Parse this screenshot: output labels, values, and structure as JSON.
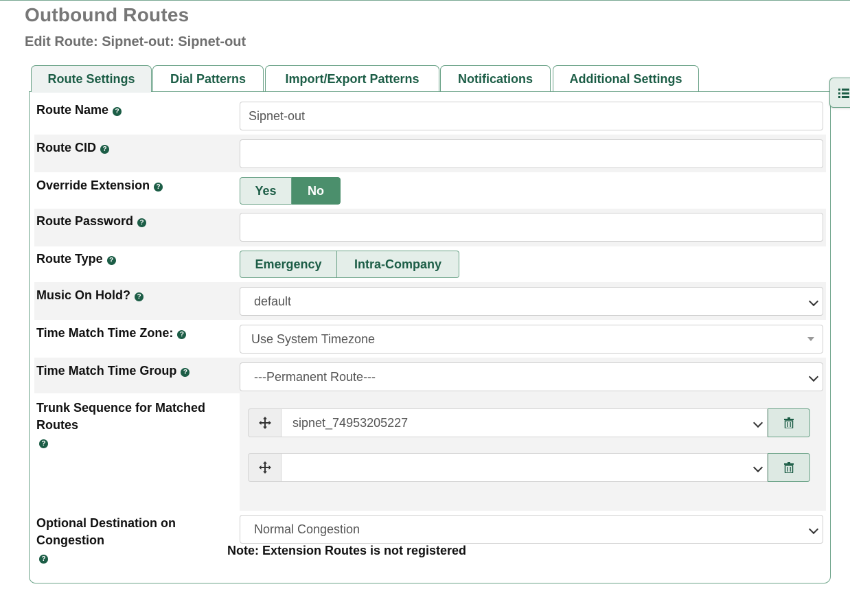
{
  "header": {
    "title": "Outbound Routes",
    "subtitle": "Edit Route: Sipnet-out: Sipnet-out"
  },
  "tabs": [
    {
      "label": "Route Settings",
      "active": true
    },
    {
      "label": "Dial Patterns"
    },
    {
      "label": "Import/Export Patterns"
    },
    {
      "label": "Notifications"
    },
    {
      "label": "Additional Settings"
    }
  ],
  "form": {
    "route_name": {
      "label": "Route Name",
      "value": "Sipnet-out"
    },
    "route_cid": {
      "label": "Route CID",
      "value": ""
    },
    "override_extension": {
      "label": "Override Extension",
      "options": [
        "Yes",
        "No"
      ],
      "selected": "No"
    },
    "route_password": {
      "label": "Route Password",
      "value": ""
    },
    "route_type": {
      "label": "Route Type",
      "options": [
        "Emergency",
        "Intra-Company"
      ]
    },
    "music_on_hold": {
      "label": "Music On Hold?",
      "selected": "default"
    },
    "time_zone": {
      "label": "Time Match Time Zone:",
      "selected": "Use System Timezone"
    },
    "time_group": {
      "label": "Time Match Time Group",
      "selected": "---Permanent Route---"
    },
    "trunk_sequence": {
      "label_line1": "Trunk Sequence for Matched",
      "label_line2": "Routes",
      "trunks": [
        "sipnet_74953205227",
        ""
      ]
    },
    "congestion": {
      "label_line1": "Optional Destination on",
      "label_line2": "Congestion",
      "selected": "Normal Congestion"
    },
    "note": "Note: Extension Routes is not registered"
  },
  "icons": {
    "help": "question-circle-icon",
    "drag": "arrows-move-icon",
    "delete": "trash-icon",
    "side_menu": "list-icon"
  },
  "colors": {
    "accent": "#1c5d46",
    "toggle_on": "#4b8f6c",
    "border": "#6aa287"
  }
}
